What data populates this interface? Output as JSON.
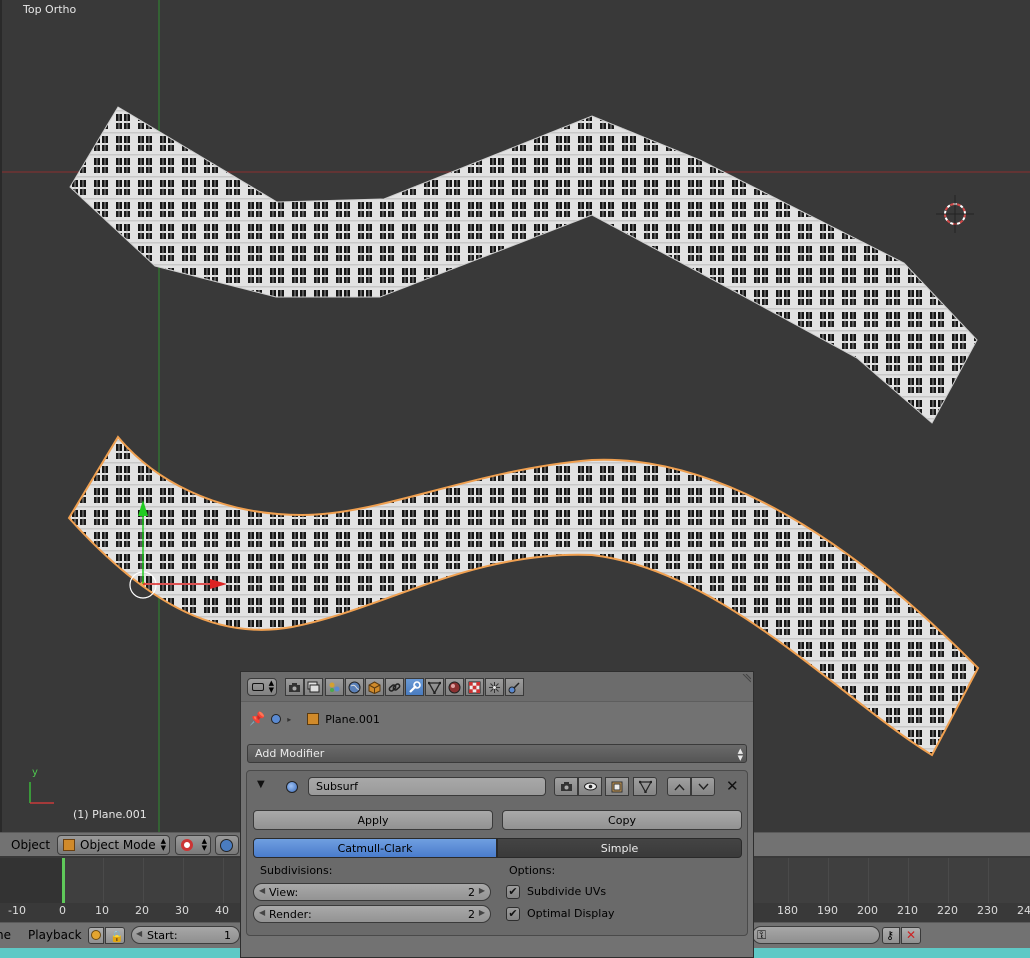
{
  "viewport": {
    "view_name": "Top Ortho",
    "object_info": "(1) Plane.001",
    "axis_labels": {
      "y": "y",
      "x": "x"
    }
  },
  "view3d_header": {
    "menu_object": "Object",
    "mode": "Object Mode"
  },
  "timeline": {
    "ticks": [
      "-10",
      "0",
      "10",
      "20",
      "30",
      "40",
      "180",
      "190",
      "200",
      "210",
      "220",
      "230",
      "24"
    ],
    "current_frame": 1
  },
  "timeline_footer": {
    "menu_cut": "ne",
    "playback": "Playback",
    "start_label": "Start:",
    "start_value": "1"
  },
  "properties": {
    "breadcrumb_object": "Plane.001",
    "context_tabs": [
      "render",
      "render-layers",
      "scene",
      "world",
      "object",
      "constraints",
      "modifiers",
      "data",
      "material",
      "texture",
      "particles",
      "physics"
    ],
    "active_tab": "modifiers",
    "add_modifier_label": "Add Modifier",
    "modifier": {
      "name": "Subsurf",
      "apply_label": "Apply",
      "copy_label": "Copy",
      "algorithm_options": [
        "Catmull-Clark",
        "Simple"
      ],
      "algorithm_selected": "Catmull-Clark",
      "subdivisions_label": "Subdivisions:",
      "view_label": "View:",
      "view_value": "2",
      "render_label": "Render:",
      "render_value": "2",
      "options_label": "Options:",
      "subdivide_uvs_label": "Subdivide UVs",
      "subdivide_uvs": true,
      "optimal_display_label": "Optimal Display",
      "optimal_display": true
    }
  },
  "colors": {
    "viewport_bg": "#393939",
    "x_axis": "#9b2f2f",
    "y_axis": "#3a9a3a",
    "selection_outline": "#f0a050",
    "active_blue": "#5a8ad2",
    "playhead": "#5fc95a"
  }
}
